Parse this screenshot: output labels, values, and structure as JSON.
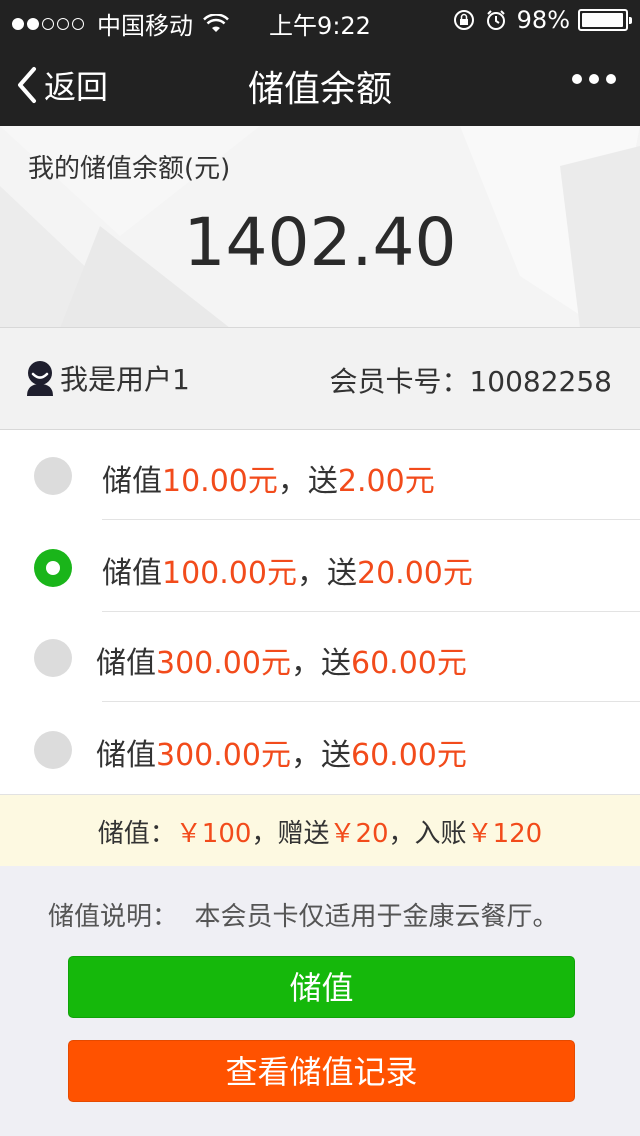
{
  "status_bar": {
    "carrier": "中国移动",
    "time": "上午9:22",
    "battery": "98%",
    "battery_level": 0.98
  },
  "nav": {
    "back_label": "返回",
    "title": "储值余额"
  },
  "balance": {
    "label": "我的储值余额(元)",
    "amount": "1402.40"
  },
  "user": {
    "name": "我是用户1",
    "card_label": "会员卡号：",
    "card_number": "10082258"
  },
  "options": [
    {
      "prefix": "储值",
      "amount": "10.00元",
      "sep": "，送",
      "bonus": "2.00元",
      "selected": false
    },
    {
      "prefix": "储值",
      "amount": "100.00元",
      "sep": "，送",
      "bonus": "20.00元",
      "selected": true
    },
    {
      "prefix": "储值",
      "amount": "300.00元",
      "sep": "，送",
      "bonus": "60.00元",
      "selected": false
    },
    {
      "prefix": "储值",
      "amount": "300.00元",
      "sep": "，送",
      "bonus": "60.00元",
      "selected": false
    }
  ],
  "summary": {
    "p1": "储值：",
    "v1": "￥100",
    "p2": "，赠送",
    "v2": "￥20",
    "p3": "，入账",
    "v3": "￥120"
  },
  "note": "储值说明：  本会员卡仅适用于金康云餐厅。",
  "buttons": {
    "recharge": "储值",
    "history": "查看储值记录"
  },
  "colors": {
    "accent_red": "#f24b1b",
    "green": "#15b80b",
    "orange": "#ff5200",
    "nav_bg": "#222222"
  }
}
